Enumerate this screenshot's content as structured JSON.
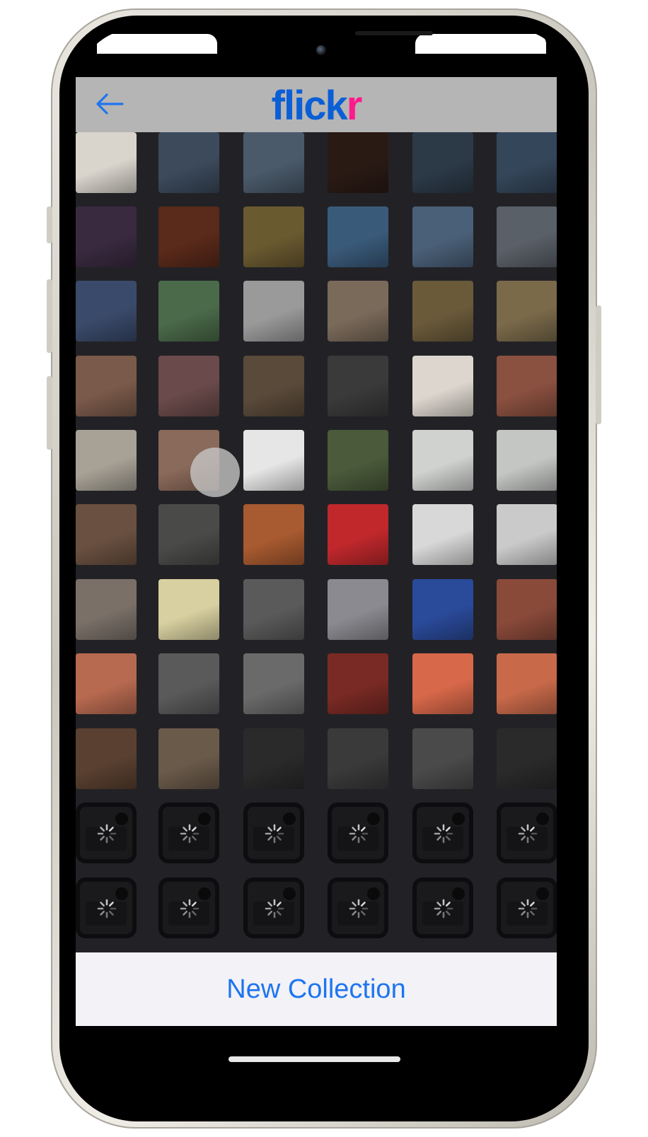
{
  "app": {
    "logo_part1": "flick",
    "logo_part2": "r",
    "brand_blue": "#0b5fd6",
    "brand_pink": "#ff1a8c"
  },
  "header": {
    "back_icon": "arrow-left-icon"
  },
  "grid": {
    "columns": 6,
    "loaded_rows": 9,
    "loading_rows": 2,
    "thumbnails": [
      [
        "#d9d4cc",
        "#3c4a5c",
        "#4a5a6a",
        "#2a1a14",
        "#2c3a48",
        "#34465a"
      ],
      [
        "#3a2a40",
        "#5a2a1a",
        "#6a5a30",
        "#3a5a7a",
        "#4a6078",
        "#5a6068"
      ],
      [
        "#3a4a6a",
        "#4a6a4a",
        "#9a9a9a",
        "#7a6a5a",
        "#6a5a3a",
        "#7a6a4a"
      ],
      [
        "#7a5a4a",
        "#6a4a4a",
        "#5a4a3a",
        "#3a3a3a",
        "#dcd6ce",
        "#8a5040"
      ],
      [
        "#a8a296",
        "#8a6a5a",
        "#e6e6e6",
        "#4a5a3a",
        "#d0d2d0",
        "#c4c6c4"
      ],
      [
        "#6a5040",
        "#4a4a48",
        "#a85a30",
        "#c0282c",
        "#d8d8d8",
        "#cacaca"
      ],
      [
        "#7a7068",
        "#d8d0a0",
        "#5a5a5a",
        "#8a8a90",
        "#2a4a9a",
        "#8a4a3a"
      ],
      [
        "#b86a50",
        "#5a5a5a",
        "#6a6a6a",
        "#7a2a24",
        "#d8684a",
        "#c86a4a"
      ],
      [
        "#5a4030",
        "#6a5a4a",
        "#2a2a2a",
        "#3a3a3a",
        "#4a4a4a",
        "#2a2a2a"
      ]
    ],
    "loading_icon": "image-loading-icon"
  },
  "footer": {
    "new_collection_label": "New Collection"
  }
}
